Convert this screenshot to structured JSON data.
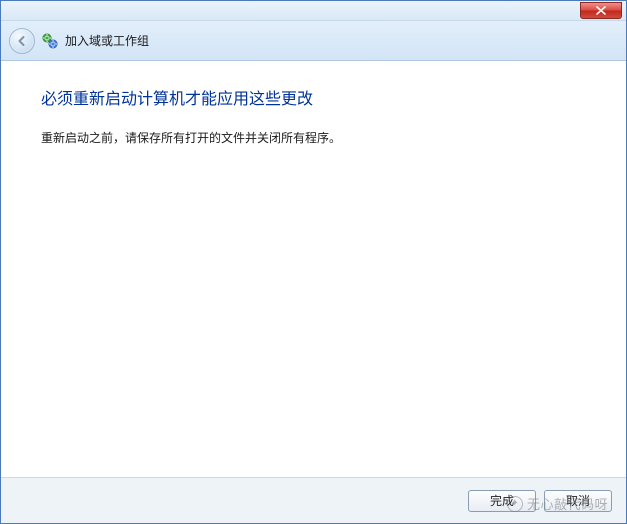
{
  "header": {
    "title": "加入域或工作组"
  },
  "content": {
    "heading": "必须重新启动计算机才能应用这些更改",
    "body": "重新启动之前，请保存所有打开的文件并关闭所有程序。"
  },
  "footer": {
    "finish_label": "完成",
    "cancel_label": "取消"
  },
  "watermark": {
    "text": "无心敲代码呀"
  }
}
